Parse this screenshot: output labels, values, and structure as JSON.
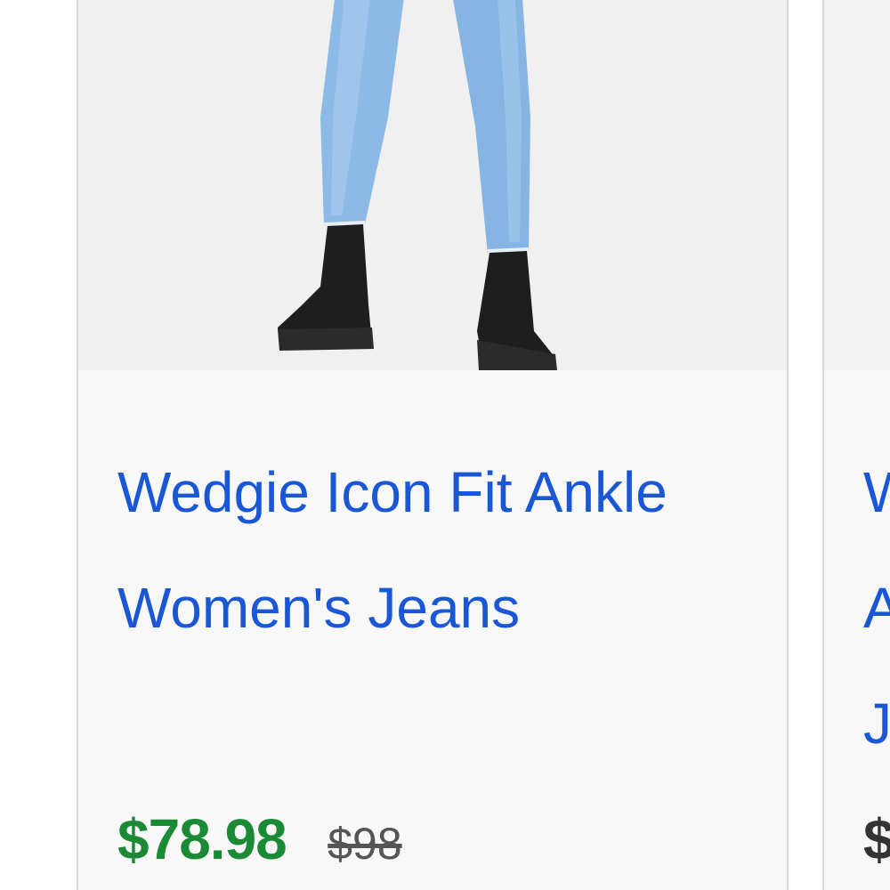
{
  "products": [
    {
      "title": "Wedgie Icon Fit Ankle Women's Jeans",
      "sale_price": "$78.98",
      "original_price": "$98"
    },
    {
      "title": "W\nA\nJ",
      "sale_price": "$",
      "original_price": ""
    }
  ],
  "colors": {
    "title_link": "#1a57d6",
    "sale_price": "#1a8a34",
    "original_price": "#555555",
    "card_border": "#d9d9dc",
    "card_background": "#f8f8f9"
  }
}
